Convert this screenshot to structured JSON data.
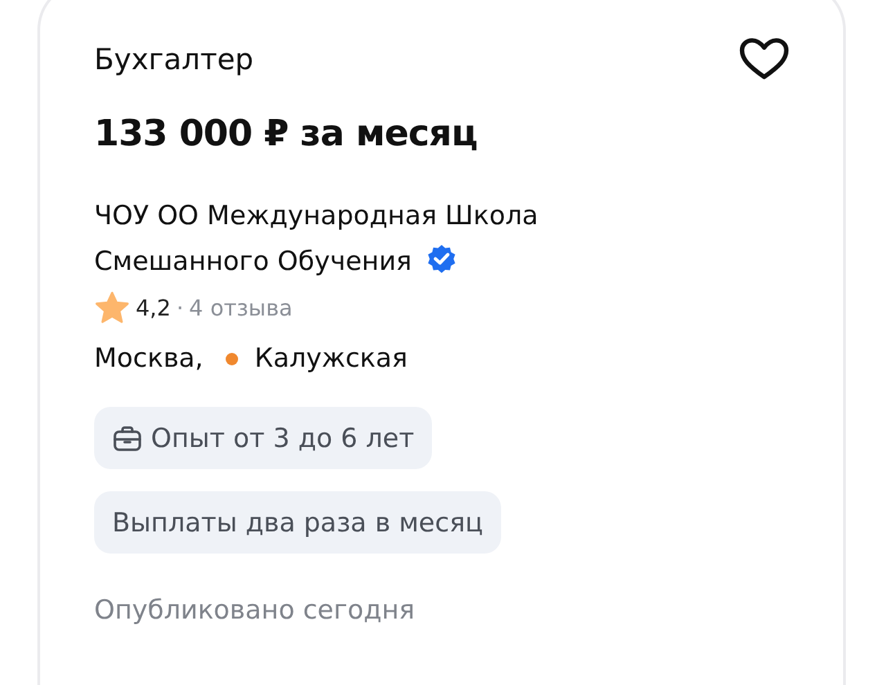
{
  "vacancy": {
    "title": "Бухгалтер",
    "favorited": false,
    "salary": "133 000 ₽ за месяц",
    "company": {
      "name": "ЧОУ ОО Международная Школа Смешанного Обучения",
      "verified": true
    },
    "rating": {
      "score": "4,2",
      "separator": "·",
      "reviews": "4 отзыва"
    },
    "location": {
      "city": "Москва,",
      "metro": {
        "name": "Калужская",
        "color": "#f0882e"
      }
    },
    "chips": [
      {
        "kind": "experience",
        "label": "Опыт от 3 до 6 лет"
      },
      {
        "kind": "plain",
        "label": "Выплаты два раза в месяц"
      }
    ],
    "published": "Опубликовано сегодня"
  }
}
